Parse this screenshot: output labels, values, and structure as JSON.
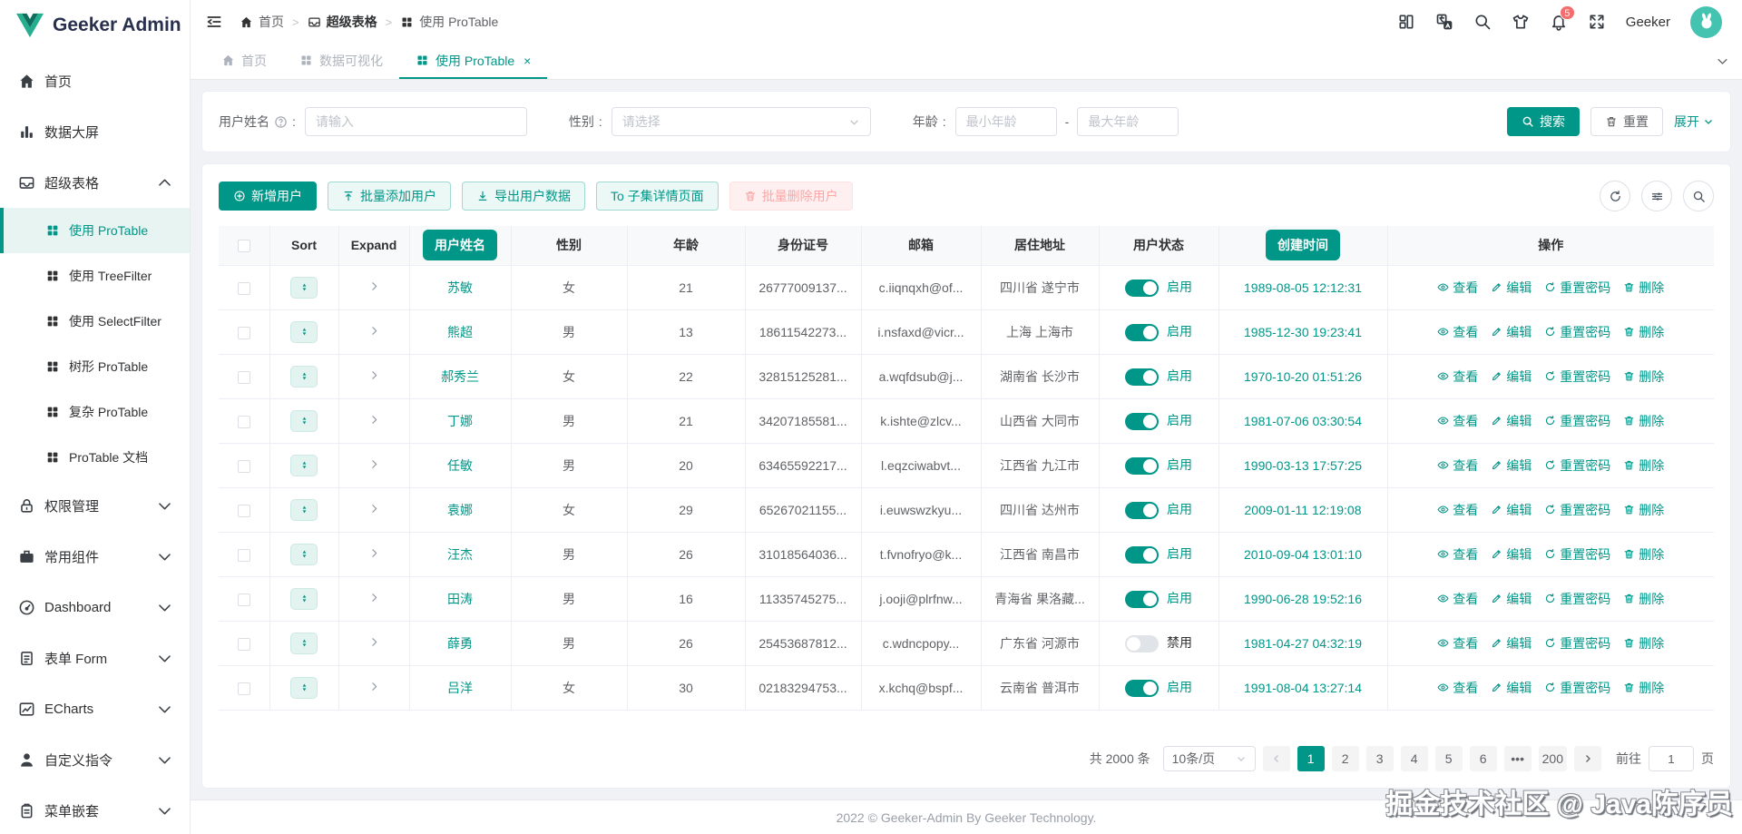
{
  "brand": {
    "name": "Geeker Admin"
  },
  "header": {
    "breadcrumb": [
      {
        "icon": "home",
        "label": "首页"
      },
      {
        "icon": "box",
        "label": "超级表格",
        "bold": true
      },
      {
        "icon": "grid",
        "label": "使用 ProTable"
      }
    ],
    "icons": [
      {
        "icon": "layout",
        "name": "layout-size"
      },
      {
        "icon": "translate",
        "name": "language"
      },
      {
        "icon": "search",
        "name": "search"
      },
      {
        "icon": "tshirt",
        "name": "theme"
      },
      {
        "icon": "bell",
        "name": "notifications",
        "badge": "5"
      },
      {
        "icon": "fullscreen",
        "name": "fullscreen"
      }
    ],
    "username": "Geeker"
  },
  "tabs": [
    {
      "icon": "home",
      "label": "首页",
      "active": false,
      "closable": false
    },
    {
      "icon": "grid",
      "label": "数据可视化",
      "active": false,
      "closable": false
    },
    {
      "icon": "grid",
      "label": "使用 ProTable",
      "active": true,
      "closable": true
    }
  ],
  "sidebar": {
    "items": [
      {
        "icon": "home",
        "label": "首页"
      },
      {
        "icon": "chart",
        "label": "数据大屏"
      },
      {
        "icon": "box",
        "label": "超级表格",
        "expanded": true,
        "children": [
          {
            "label": "使用 ProTable",
            "active": true
          },
          {
            "label": "使用 TreeFilter"
          },
          {
            "label": "使用 SelectFilter"
          },
          {
            "label": "树形 ProTable"
          },
          {
            "label": "复杂 ProTable"
          },
          {
            "label": "ProTable 文档"
          }
        ]
      },
      {
        "icon": "lock",
        "label": "权限管理",
        "collapsible": true
      },
      {
        "icon": "briefcase",
        "label": "常用组件",
        "collapsible": true
      },
      {
        "icon": "dashboard",
        "label": "Dashboard",
        "collapsible": true
      },
      {
        "icon": "form",
        "label": "表单 Form",
        "collapsible": true
      },
      {
        "icon": "echarts",
        "label": "ECharts",
        "collapsible": true
      },
      {
        "icon": "person",
        "label": "自定义指令",
        "collapsible": true
      },
      {
        "icon": "clipboard",
        "label": "菜单嵌套",
        "collapsible": true
      }
    ]
  },
  "filter": {
    "name_label": "用户姓名",
    "name_placeholder": "请输入",
    "gender_label": "性别",
    "gender_placeholder": "请选择",
    "age_label": "年龄",
    "age_min_placeholder": "最小年龄",
    "age_max_placeholder": "最大年龄",
    "range_dash": "-",
    "search_label": "搜索",
    "reset_label": "重置",
    "expand_label": "展开"
  },
  "toolbar": {
    "buttons": [
      {
        "label": "新增用户",
        "icon": "plus-circle",
        "type": "primary"
      },
      {
        "label": "批量添加用户",
        "icon": "upload",
        "type": "plain"
      },
      {
        "label": "导出用户数据",
        "icon": "download",
        "type": "plain"
      },
      {
        "label": "To 子集详情页面",
        "icon": "",
        "type": "plain"
      },
      {
        "label": "批量删除用户",
        "icon": "trash",
        "type": "danger-disabled"
      }
    ],
    "right_icons": [
      {
        "icon": "refresh",
        "name": "refresh-table"
      },
      {
        "icon": "sliders",
        "name": "column-settings"
      },
      {
        "icon": "search",
        "name": "toggle-search"
      }
    ]
  },
  "table": {
    "columns": [
      {
        "key": "select",
        "label": ""
      },
      {
        "key": "sort",
        "label": "Sort"
      },
      {
        "key": "expand",
        "label": "Expand"
      },
      {
        "key": "name",
        "label": "用户姓名",
        "pill": true
      },
      {
        "key": "gender",
        "label": "性别"
      },
      {
        "key": "age",
        "label": "年龄"
      },
      {
        "key": "idCard",
        "label": "身份证号"
      },
      {
        "key": "email",
        "label": "邮箱"
      },
      {
        "key": "address",
        "label": "居住地址"
      },
      {
        "key": "status",
        "label": "用户状态"
      },
      {
        "key": "createTime",
        "label": "创建时间",
        "pill": true
      },
      {
        "key": "operation",
        "label": "操作"
      }
    ],
    "status_on": "启用",
    "status_off": "禁用",
    "actions": [
      {
        "icon": "eye",
        "label": "查看",
        "name": "view"
      },
      {
        "icon": "edit",
        "label": "编辑",
        "name": "edit"
      },
      {
        "icon": "refresh",
        "label": "重置密码",
        "name": "reset-password"
      },
      {
        "icon": "trash",
        "label": "删除",
        "name": "delete"
      }
    ],
    "rows": [
      {
        "name": "苏敏",
        "gender": "女",
        "age": "21",
        "idCard": "26777009137...",
        "email": "c.iiqnqxh@of...",
        "address": "四川省 遂宁市",
        "status": true,
        "createTime": "1989-08-05 12:12:31"
      },
      {
        "name": "熊超",
        "gender": "男",
        "age": "13",
        "idCard": "18611542273...",
        "email": "i.nsfaxd@vicr...",
        "address": "上海 上海市",
        "status": true,
        "createTime": "1985-12-30 19:23:41"
      },
      {
        "name": "郝秀兰",
        "gender": "女",
        "age": "22",
        "idCard": "32815125281...",
        "email": "a.wqfdsub@j...",
        "address": "湖南省 长沙市",
        "status": true,
        "createTime": "1970-10-20 01:51:26"
      },
      {
        "name": "丁娜",
        "gender": "男",
        "age": "21",
        "idCard": "34207185581...",
        "email": "k.ishte@zlcv...",
        "address": "山西省 大同市",
        "status": true,
        "createTime": "1981-07-06 03:30:54"
      },
      {
        "name": "任敏",
        "gender": "男",
        "age": "20",
        "idCard": "63465592217...",
        "email": "l.eqzciwabvt...",
        "address": "江西省 九江市",
        "status": true,
        "createTime": "1990-03-13 17:57:25"
      },
      {
        "name": "袁娜",
        "gender": "女",
        "age": "29",
        "idCard": "65267021155...",
        "email": "i.euwswzkyu...",
        "address": "四川省 达州市",
        "status": true,
        "createTime": "2009-01-11 12:19:08"
      },
      {
        "name": "汪杰",
        "gender": "男",
        "age": "26",
        "idCard": "31018564036...",
        "email": "t.fvnofryo@k...",
        "address": "江西省 南昌市",
        "status": true,
        "createTime": "2010-09-04 13:01:10"
      },
      {
        "name": "田涛",
        "gender": "男",
        "age": "16",
        "idCard": "11335745275...",
        "email": "j.ooji@plrfnw...",
        "address": "青海省 果洛藏...",
        "status": true,
        "createTime": "1990-06-28 19:52:16"
      },
      {
        "name": "薛勇",
        "gender": "男",
        "age": "26",
        "idCard": "25453687812...",
        "email": "c.wdncpopy...",
        "address": "广东省 河源市",
        "status": false,
        "createTime": "1981-04-27 04:32:19"
      },
      {
        "name": "吕洋",
        "gender": "女",
        "age": "30",
        "idCard": "02183294753...",
        "email": "x.kchq@bspf...",
        "address": "云南省 普洱市",
        "status": true,
        "createTime": "1991-08-04 13:27:14"
      }
    ]
  },
  "pagination": {
    "total_text": "共 2000 条",
    "page_size": "10条/页",
    "pages": [
      "1",
      "2",
      "3",
      "4",
      "5",
      "6",
      "...",
      "200"
    ],
    "active_page": "1",
    "goto_label": "前往",
    "goto_value": "1",
    "page_label": "页"
  },
  "footer": {
    "copyright": "2022 © Geeker-Admin By Geeker Technology."
  },
  "watermark": "掘金技术社区 @ Java陈序员",
  "colors": {
    "primary": "#009688",
    "danger": "#f56c6c",
    "header_bg": "#f8f9fb"
  }
}
